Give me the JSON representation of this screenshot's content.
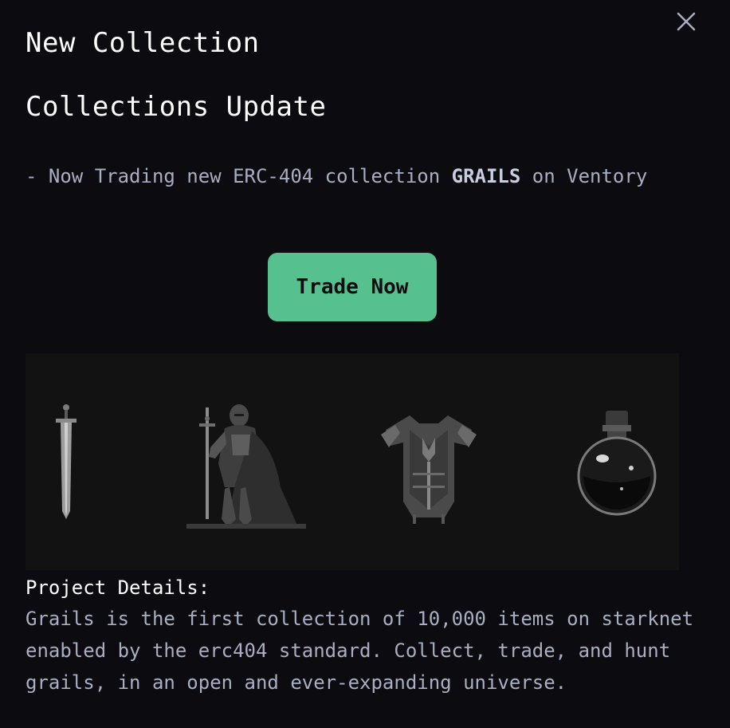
{
  "modal": {
    "title": "New Collection",
    "subtitle": "Collections Update",
    "announcement": {
      "prefix": "- Now Trading new ERC-404 collection ",
      "highlight": "GRAILS",
      "suffix": " on Ventory"
    },
    "trade_button_label": "Trade Now",
    "close_icon": "close-icon",
    "banner_items": [
      "sword-icon",
      "knight-icon",
      "armor-icon",
      "potion-icon"
    ],
    "details_heading": "Project Details:",
    "details_text": "Grails is the first collection of 10,000 items on starknet enabled by the erc404 standard. Collect, trade, and hunt grails, in an open and ever-expanding universe."
  },
  "colors": {
    "background": "#0b0b10",
    "accent": "#56c08f",
    "muted_text": "#a9aec2",
    "banner_bg": "#121212"
  }
}
